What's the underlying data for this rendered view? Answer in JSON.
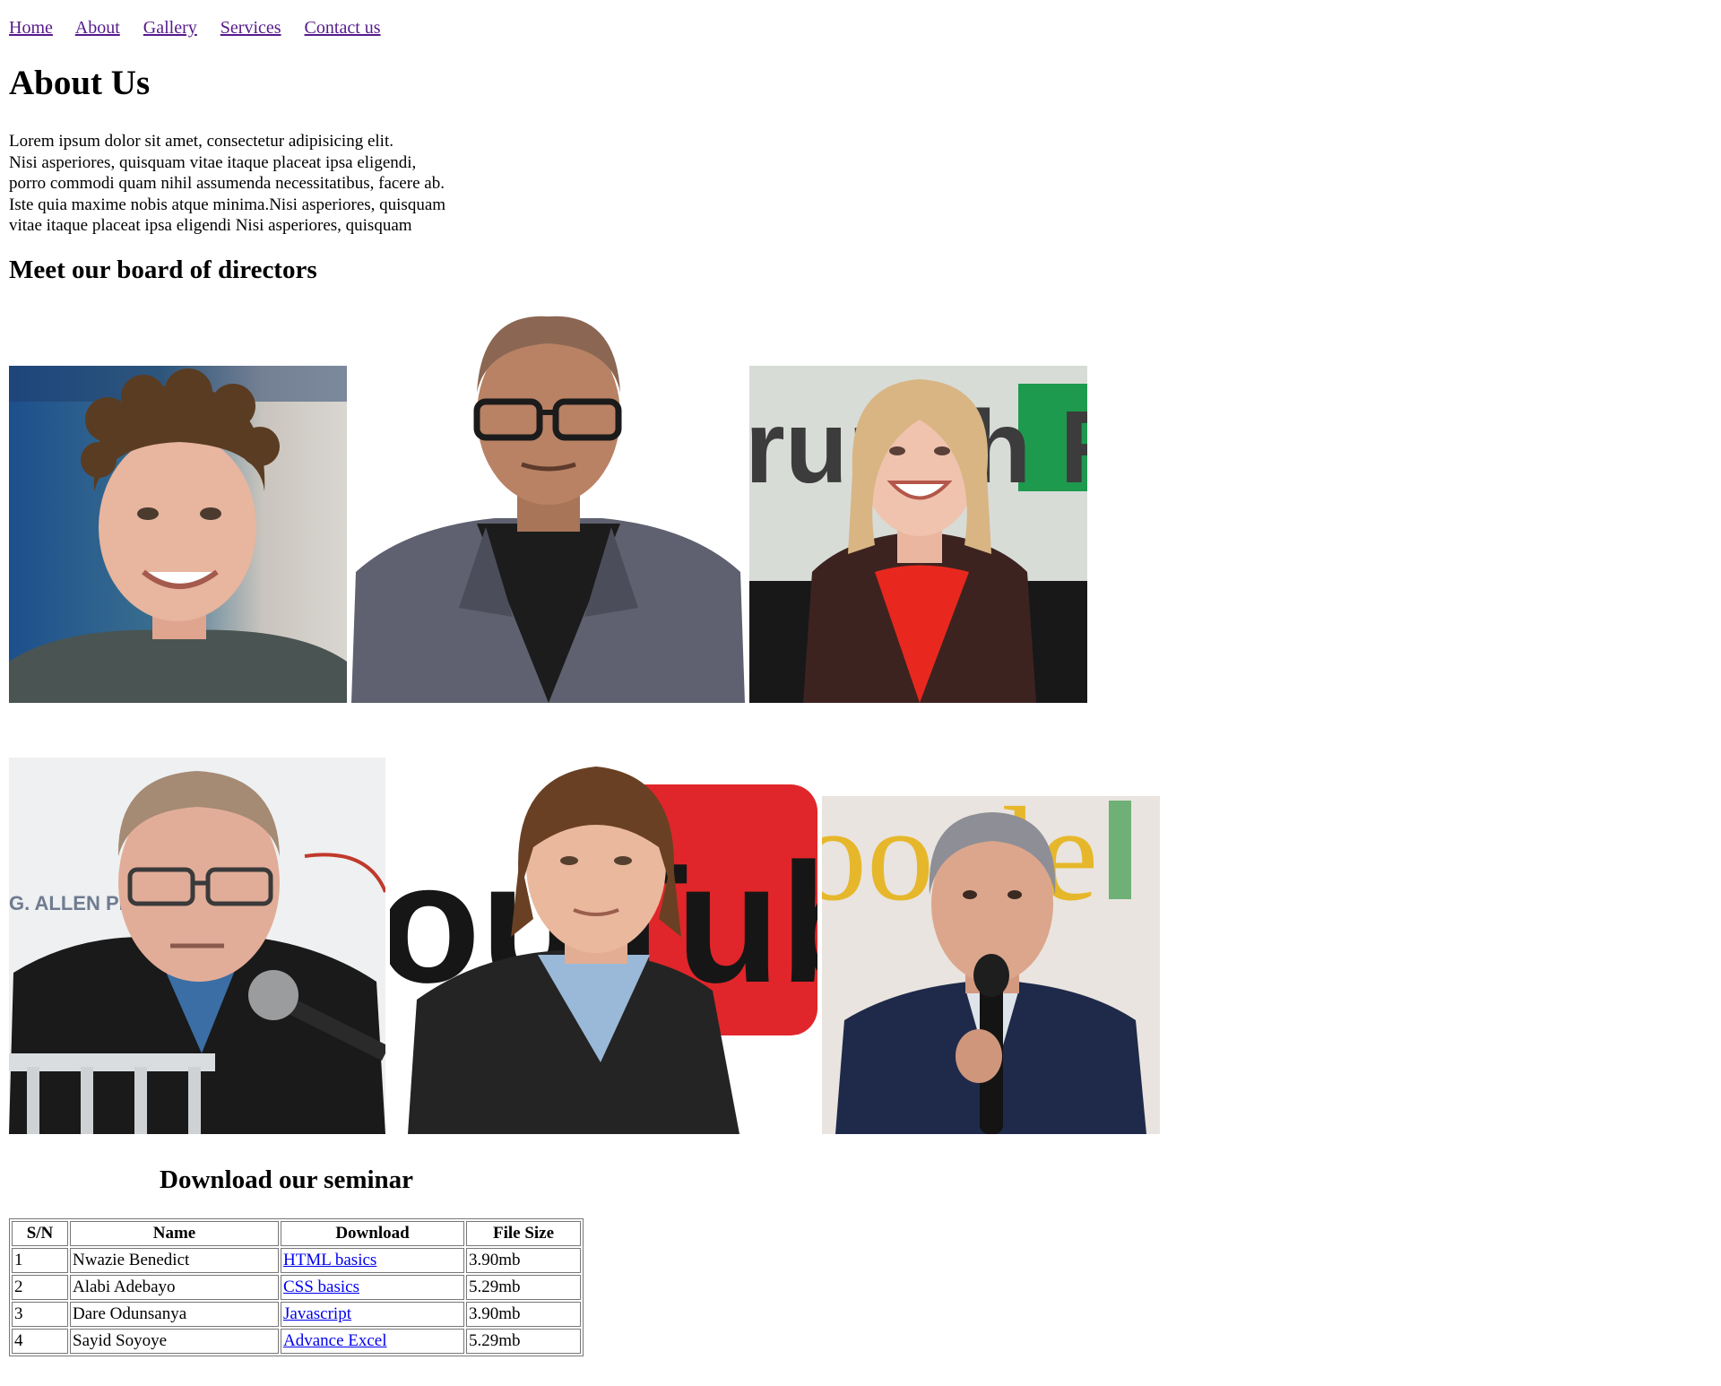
{
  "nav": {
    "items": [
      {
        "label": "Home"
      },
      {
        "label": "About"
      },
      {
        "label": "Gallery"
      },
      {
        "label": "Services"
      },
      {
        "label": "Contact us"
      }
    ]
  },
  "page": {
    "title": "About Us",
    "intro_lines": [
      "Lorem ipsum dolor sit amet, consectetur adipisicing elit.",
      "Nisi asperiores, quisquam vitae itaque placeat ipsa eligendi,",
      "porro commodi quam nihil assumenda necessitatibus, facere ab.",
      "Iste quia maxime nobis atque minima.Nisi asperiores, quisquam",
      "vitae itaque placeat ipsa eligendi Nisi asperiores, quisquam"
    ],
    "board_heading": "Meet our board of directors"
  },
  "board": {
    "photos": [
      {
        "icon": "director-photo-1"
      },
      {
        "icon": "director-photo-2"
      },
      {
        "icon": "director-photo-3"
      },
      {
        "icon": "director-photo-4"
      },
      {
        "icon": "director-photo-5"
      },
      {
        "icon": "director-photo-6"
      }
    ],
    "photo_text": {
      "banner_3": "runch RUST",
      "banner_5": "ouTub",
      "banner_6": "oogle"
    }
  },
  "seminar": {
    "heading": "Download our seminar",
    "columns": [
      "S/N",
      "Name",
      "Download",
      "File Size"
    ],
    "rows": [
      {
        "sn": "1",
        "name": "Nwazie Benedict",
        "download": "HTML basics",
        "size": "3.90mb"
      },
      {
        "sn": "2",
        "name": "Alabi Adebayo",
        "download": "CSS basics",
        "size": "5.29mb"
      },
      {
        "sn": "3",
        "name": "Dare Odunsanya",
        "download": "Javascript",
        "size": "3.90mb"
      },
      {
        "sn": "4",
        "name": "Sayid Soyoye",
        "download": "Advance Excel",
        "size": "5.29mb"
      }
    ]
  },
  "colors": {
    "visited_link": "#551a8b",
    "link": "#0000ee"
  }
}
